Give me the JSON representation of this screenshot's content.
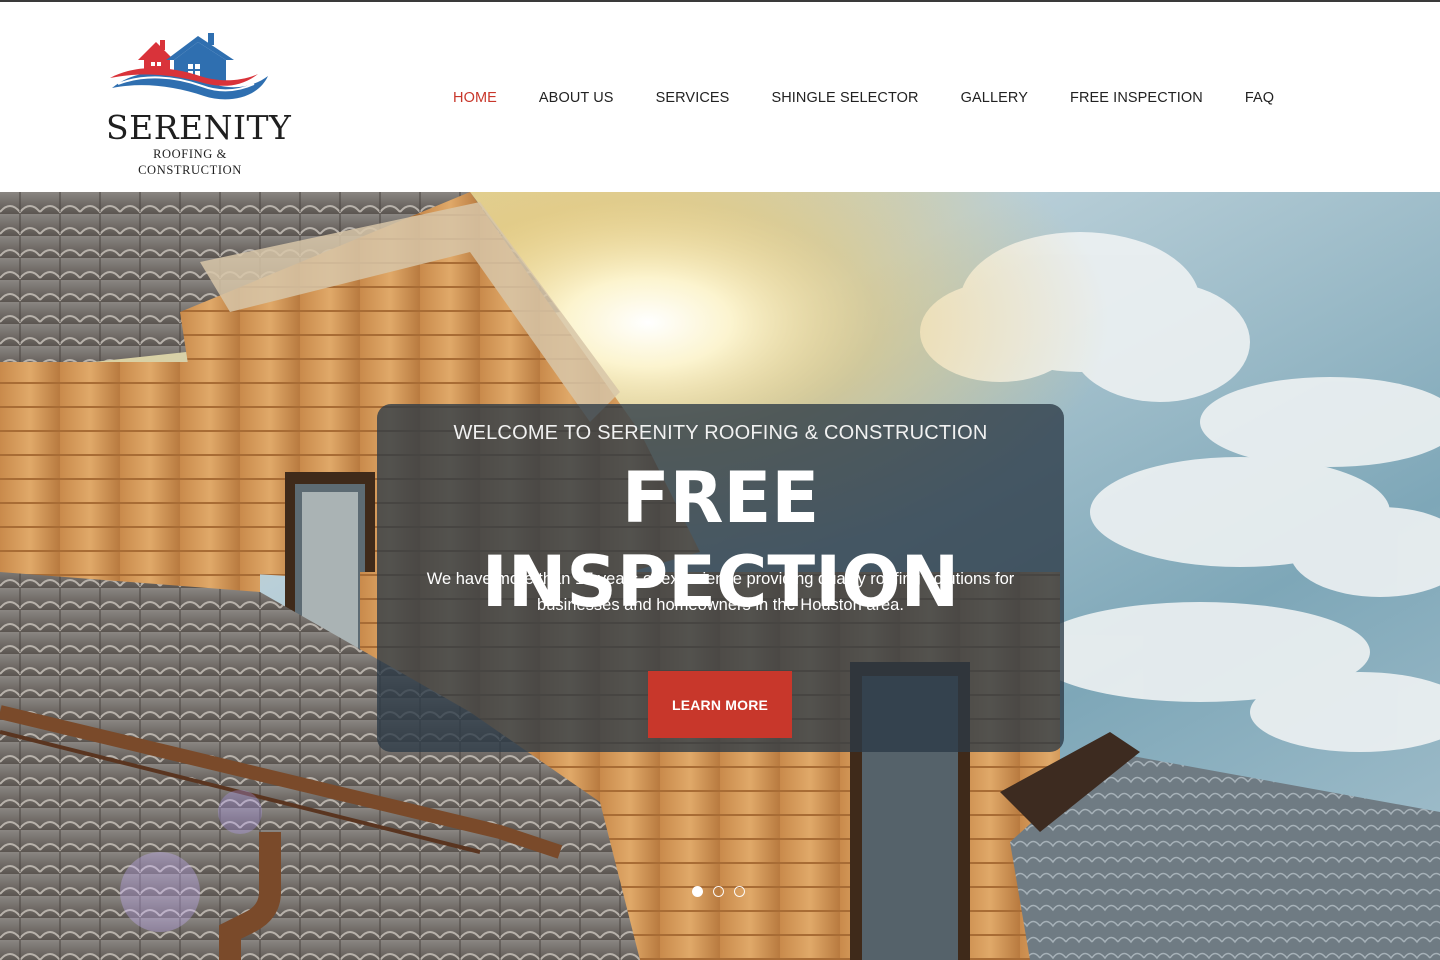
{
  "brand": {
    "name": "SERENITY",
    "tagline": "ROOFING & CONSTRUCTION",
    "logo_icon": "houses-wave-logo",
    "colors": {
      "red": "#d9333a",
      "blue": "#2f6fb0"
    }
  },
  "nav": {
    "items": [
      {
        "label": "HOME",
        "active": true
      },
      {
        "label": "ABOUT US",
        "active": false
      },
      {
        "label": "SERVICES",
        "active": false
      },
      {
        "label": "SHINGLE SELECTOR",
        "active": false
      },
      {
        "label": "GALLERY",
        "active": false
      },
      {
        "label": "FREE INSPECTION",
        "active": false
      },
      {
        "label": "FAQ",
        "active": false
      }
    ],
    "active_color": "#c8372b"
  },
  "hero": {
    "eyebrow": "WELCOME TO SERENITY ROOFING & CONSTRUCTION",
    "title": "FREE INSPECTION",
    "description": "We have more than 17 years of experience providing quality roofing solutions for businesses and homeowners in the Houston area.",
    "button_label": "LEARN MORE",
    "button_color": "#c8372b",
    "slides": {
      "count": 3,
      "active_index": 0
    }
  }
}
